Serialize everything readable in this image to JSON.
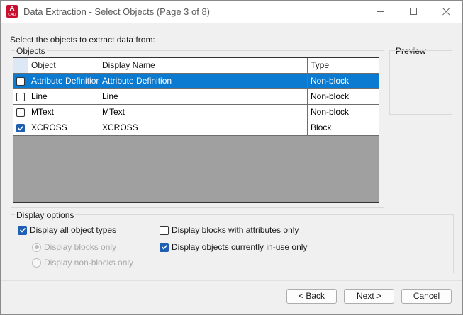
{
  "window": {
    "title": "Data Extraction - Select Objects (Page 3 of 8)",
    "app_icon_letter": "A",
    "app_icon_sub": "CAD",
    "accent_color": "#0b7ad1",
    "app_icon_color": "#c8102e"
  },
  "instruction": "Select the objects to extract data from:",
  "objects_group": {
    "title": "Objects",
    "columns": [
      "",
      "Object",
      "Display Name",
      "Type"
    ],
    "rows": [
      {
        "checked": false,
        "object": "Attribute Definition",
        "display_name": "Attribute Definition",
        "type": "Non-block",
        "selected": true
      },
      {
        "checked": false,
        "object": "Line",
        "display_name": "Line",
        "type": "Non-block",
        "selected": false
      },
      {
        "checked": false,
        "object": "MText",
        "display_name": "MText",
        "type": "Non-block",
        "selected": false
      },
      {
        "checked": true,
        "object": "XCROSS",
        "display_name": "XCROSS",
        "type": "Block",
        "selected": false
      }
    ]
  },
  "preview": {
    "title": "Preview"
  },
  "display_options": {
    "title": "Display options",
    "all_types_label": "Display all object types",
    "all_types_checked": true,
    "blocks_only_label": "Display blocks only",
    "non_blocks_only_label": "Display non-blocks only",
    "blocks_with_attributes_label": "Display blocks with attributes only",
    "blocks_with_attributes_checked": false,
    "in_use_label": "Display objects currently in-use only",
    "in_use_checked": true
  },
  "buttons": {
    "back": "< Back",
    "next": "Next >",
    "cancel": "Cancel"
  }
}
